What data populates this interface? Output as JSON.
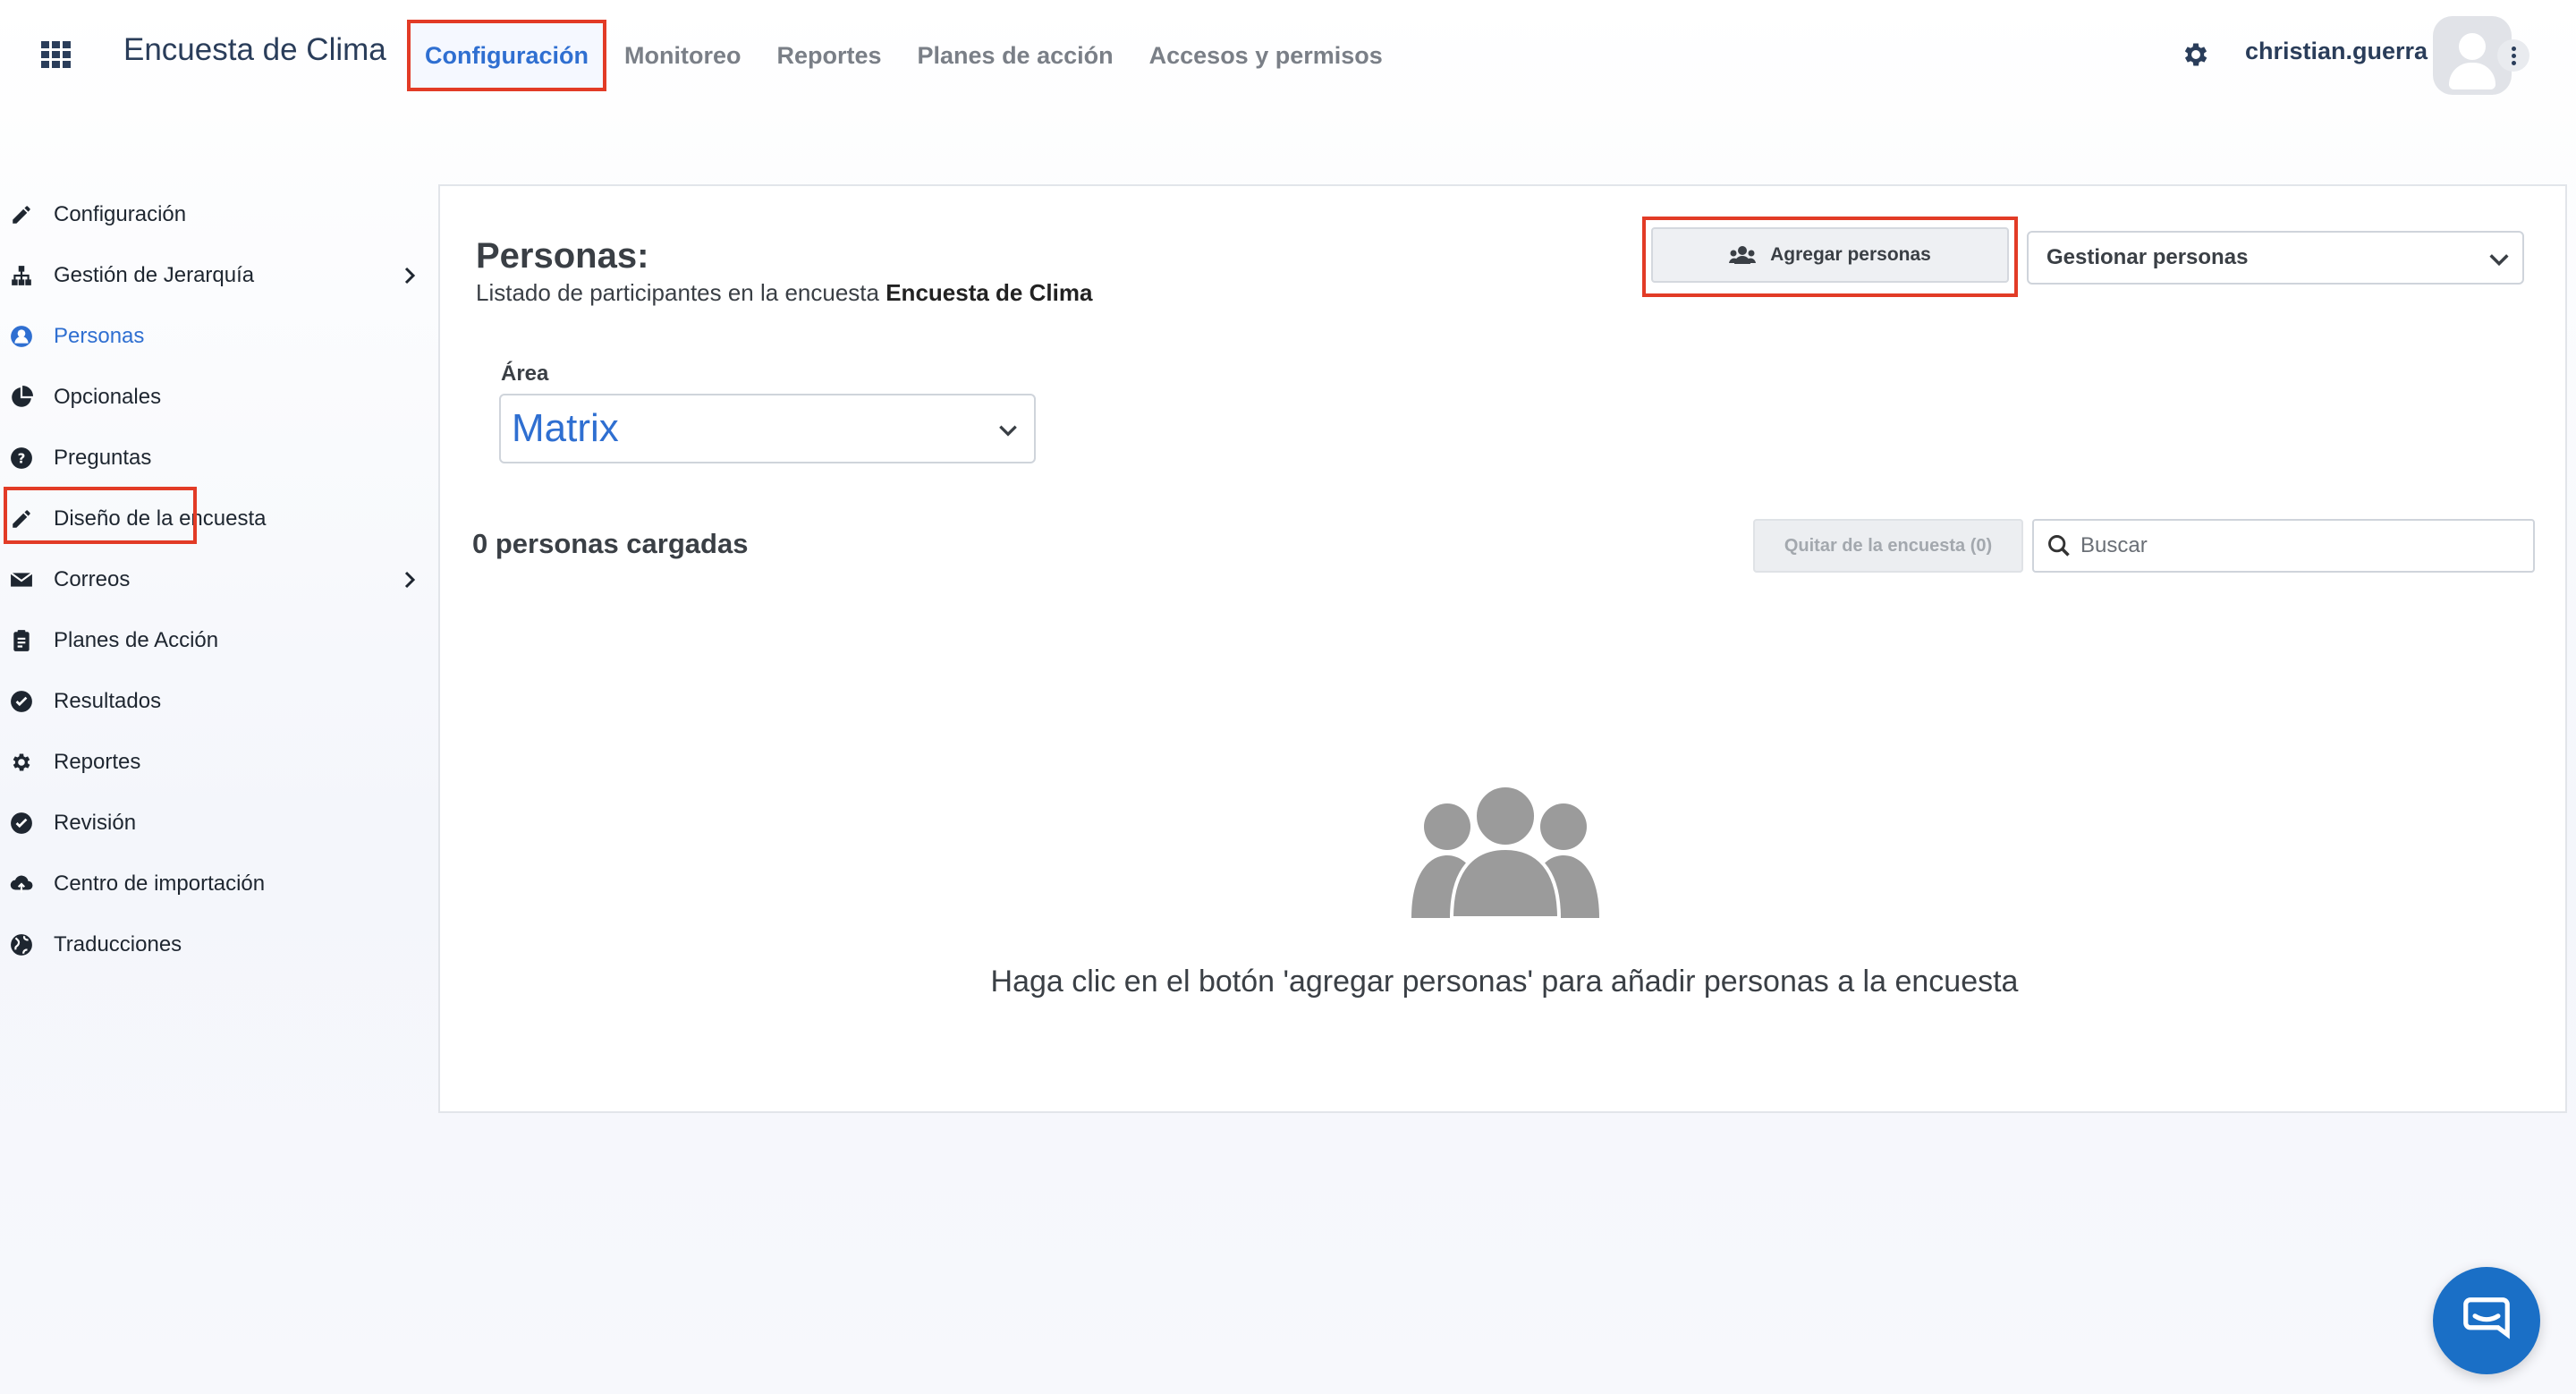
{
  "app": {
    "title": "Encuesta de Clima"
  },
  "nav": {
    "items": [
      {
        "label": "Configuración",
        "active": true
      },
      {
        "label": "Monitoreo"
      },
      {
        "label": "Reportes"
      },
      {
        "label": "Planes de acción"
      },
      {
        "label": "Accesos y permisos"
      }
    ]
  },
  "user": {
    "name": "christian.guerra"
  },
  "sidebar": {
    "items": [
      {
        "label": "Configuración",
        "icon": "pencil-icon"
      },
      {
        "label": "Gestión de Jerarquía",
        "icon": "sitemap-icon",
        "has_children": true
      },
      {
        "label": "Personas",
        "icon": "user-icon",
        "active": true
      },
      {
        "label": "Opcionales",
        "icon": "pie-icon"
      },
      {
        "label": "Preguntas",
        "icon": "question-icon"
      },
      {
        "label": "Diseño de la encuesta",
        "icon": "pencil-icon"
      },
      {
        "label": "Correos",
        "icon": "envelope-icon",
        "has_children": true
      },
      {
        "label": "Planes de Acción",
        "icon": "clipboard-icon"
      },
      {
        "label": "Resultados",
        "icon": "check-circle-icon"
      },
      {
        "label": "Reportes",
        "icon": "gear-icon"
      },
      {
        "label": "Revisión",
        "icon": "check-circle-icon"
      },
      {
        "label": "Centro de importación",
        "icon": "cloud-upload-icon"
      },
      {
        "label": "Traducciones",
        "icon": "globe-icon"
      }
    ]
  },
  "main": {
    "title": "Personas:",
    "subtitle_prefix": "Listado de participantes en la encuesta",
    "subtitle_survey": "Encuesta de Clima",
    "add_button": "Agregar personas",
    "manage_select": "Gestionar personas",
    "area_label": "Área",
    "area_value": "Matrix",
    "count_label": "0 personas cargadas",
    "remove_button": "Quitar de la encuesta (0)",
    "search_placeholder": "Buscar",
    "empty_message": "Haga clic en el botón 'agregar personas' para añadir personas a la encuesta"
  },
  "colors": {
    "accent": "#2f6fd1",
    "highlight": "#e23b26",
    "brand_dark": "#2a3d5a",
    "chat": "#1a6fc6"
  }
}
